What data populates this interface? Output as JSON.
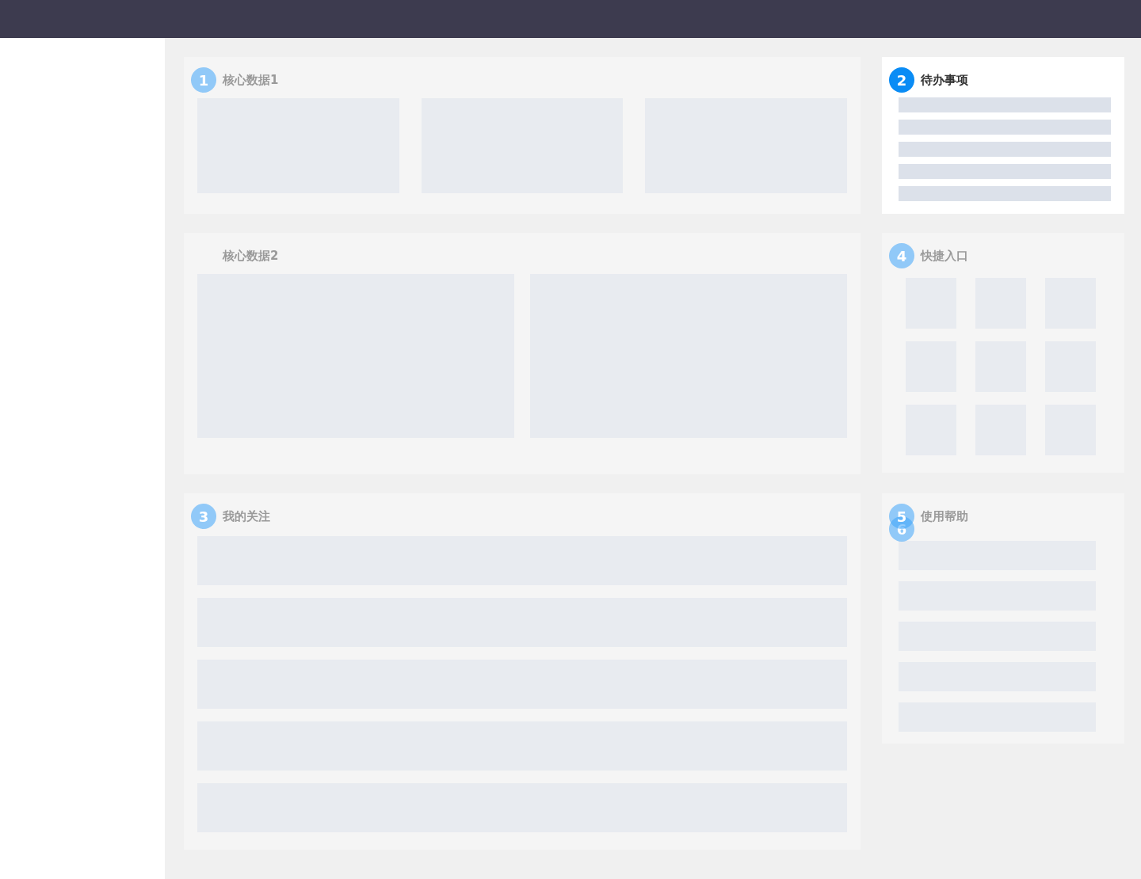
{
  "panels": [
    {
      "kind": "stats",
      "title": "核心数据1",
      "selected": false,
      "steps": [
        {
          "label": "1",
          "selected": false
        }
      ]
    },
    {
      "kind": "todo",
      "title": "待办事项",
      "selected": true,
      "steps": [
        {
          "label": "2",
          "selected": true
        }
      ]
    },
    {
      "kind": "charts",
      "title": "核心数据2",
      "selected": false
    },
    {
      "kind": "shortcuts",
      "title": "快捷入口",
      "selected": false,
      "steps": [
        {
          "label": "4",
          "selected": false
        }
      ]
    },
    {
      "kind": "follow",
      "title": "我的关注",
      "selected": false,
      "steps": [
        {
          "label": "3",
          "selected": false
        }
      ]
    },
    {
      "kind": "help",
      "title": "使用帮助",
      "selected": false,
      "steps": [
        {
          "label": "5",
          "selected": false
        },
        {
          "label": "6",
          "selected": false
        }
      ]
    }
  ]
}
